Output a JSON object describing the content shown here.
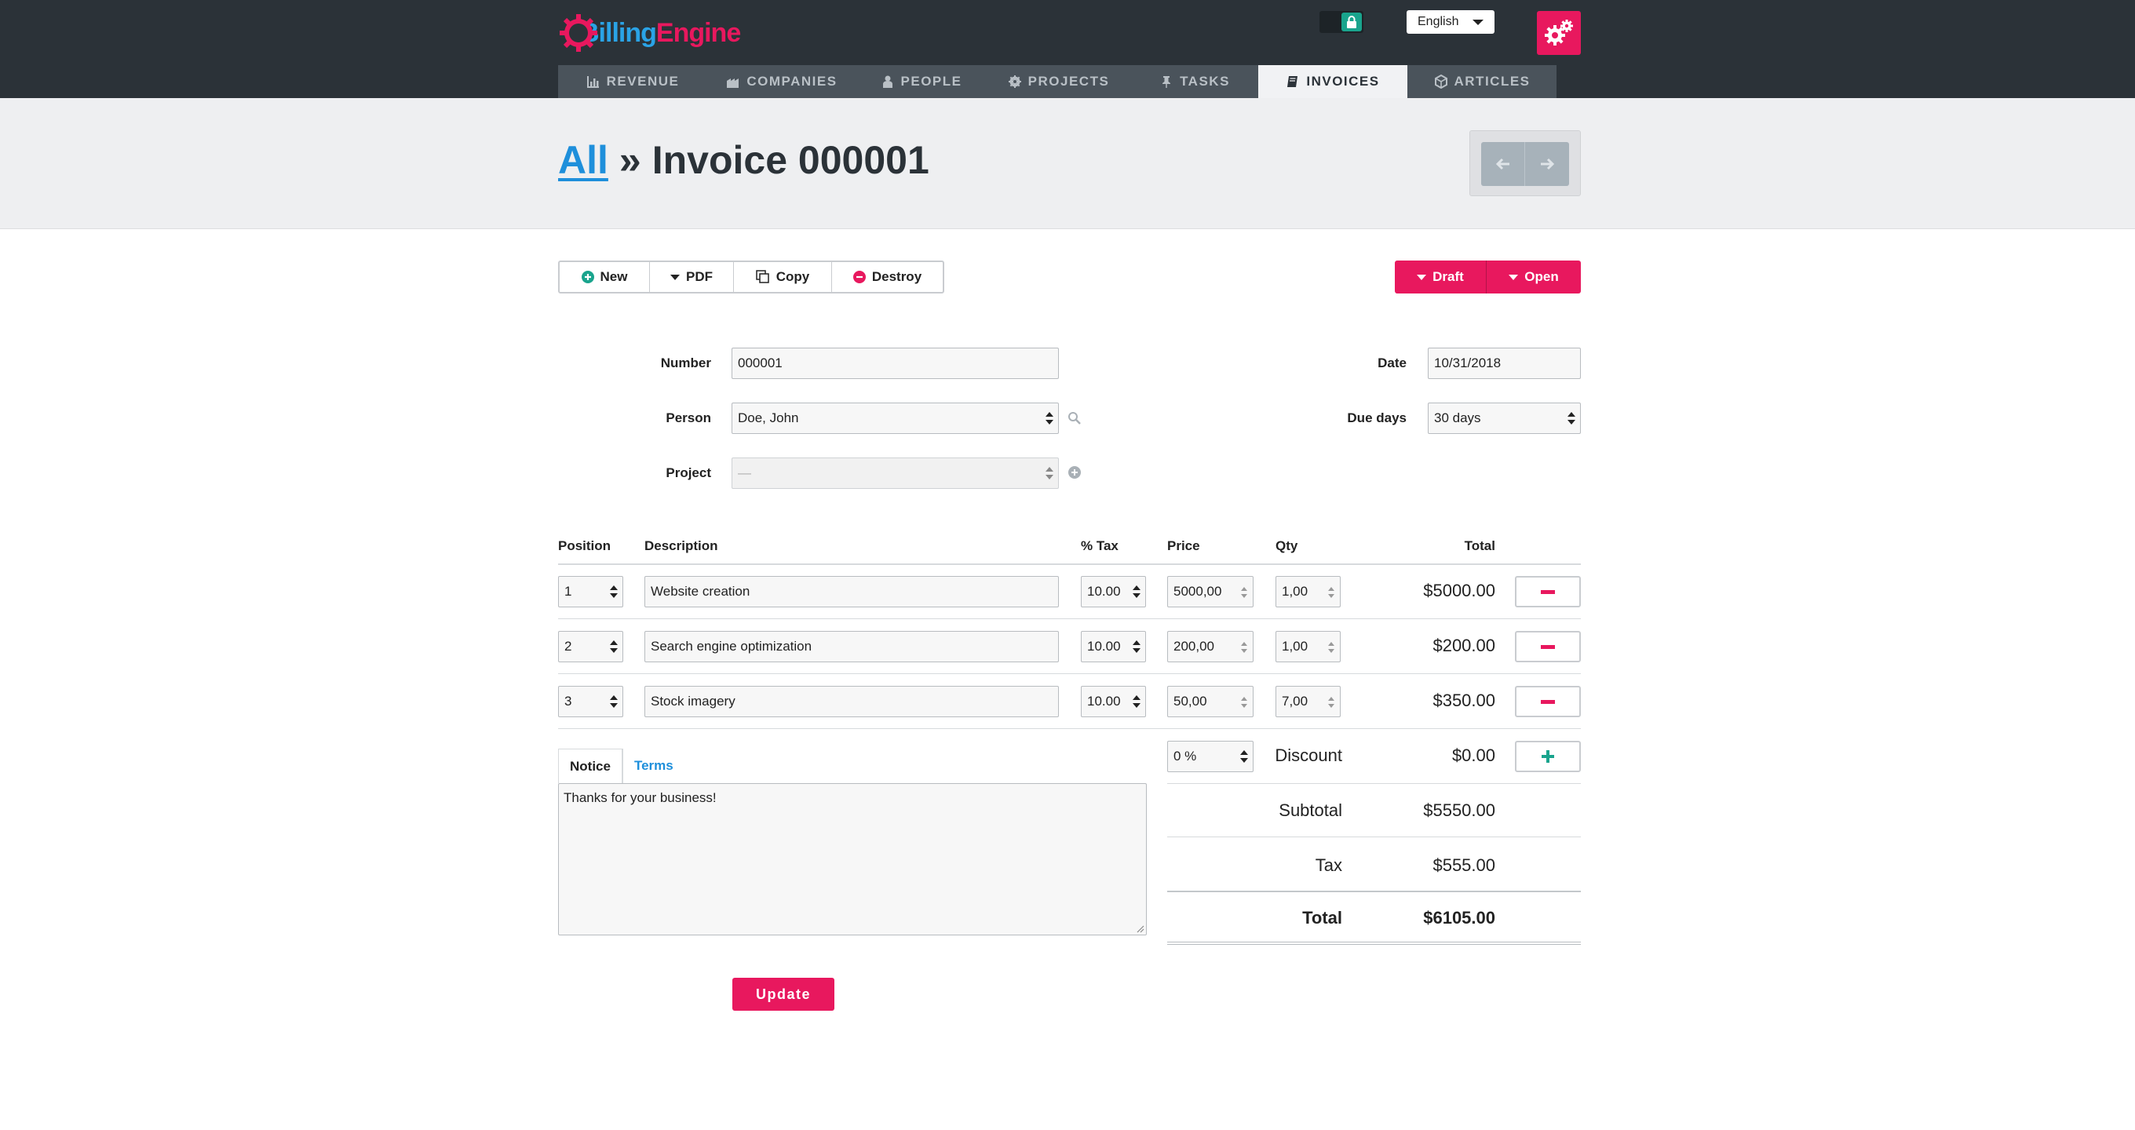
{
  "brand": {
    "name_part1": "Billing",
    "name_part2": "Engine"
  },
  "language": {
    "selected": "English"
  },
  "nav": {
    "tabs": [
      {
        "label": "REVENUE",
        "icon": "bar-chart-icon"
      },
      {
        "label": "COMPANIES",
        "icon": "building-icon"
      },
      {
        "label": "PEOPLE",
        "icon": "user-icon"
      },
      {
        "label": "PROJECTS",
        "icon": "gear-icon"
      },
      {
        "label": "TASKS",
        "icon": "pin-icon"
      },
      {
        "label": "INVOICES",
        "icon": "book-icon",
        "active": true
      },
      {
        "label": "ARTICLES",
        "icon": "cube-icon"
      }
    ]
  },
  "breadcrumb": {
    "parent": "All",
    "separator": "»",
    "current": "Invoice 000001"
  },
  "toolbar": {
    "new": "New",
    "pdf": "PDF",
    "copy": "Copy",
    "destroy": "Destroy"
  },
  "status": {
    "draft": "Draft",
    "open": "Open"
  },
  "form": {
    "number_label": "Number",
    "number_value": "000001",
    "person_label": "Person",
    "person_value": "Doe, John",
    "project_label": "Project",
    "project_value": "—",
    "date_label": "Date",
    "date_value": "10/31/2018",
    "due_days_label": "Due days",
    "due_days_value": "30 days"
  },
  "table": {
    "headers": {
      "position": "Position",
      "description": "Description",
      "tax": "% Tax",
      "price": "Price",
      "qty": "Qty",
      "total": "Total"
    },
    "rows": [
      {
        "position": "1",
        "description": "Website creation",
        "tax": "10.00",
        "price": "5000,00",
        "qty": "1,00",
        "total": "$5000.00"
      },
      {
        "position": "2",
        "description": "Search engine optimization",
        "tax": "10.00",
        "price": "200,00",
        "qty": "1,00",
        "total": "$200.00"
      },
      {
        "position": "3",
        "description": "Stock imagery",
        "tax": "10.00",
        "price": "50,00",
        "qty": "7,00",
        "total": "$350.00"
      }
    ]
  },
  "notice": {
    "tab_notice": "Notice",
    "tab_terms": "Terms",
    "text": "Thanks for your business!"
  },
  "summary": {
    "discount_select": "0 %",
    "discount_label": "Discount",
    "discount_value": "$0.00",
    "subtotal_label": "Subtotal",
    "subtotal_value": "$5550.00",
    "tax_label": "Tax",
    "tax_value": "$555.00",
    "total_label": "Total",
    "total_value": "$6105.00"
  },
  "actions": {
    "update": "Update"
  },
  "colors": {
    "accent": "#e8185e",
    "link": "#1e8fdb",
    "topbar": "#2b3238",
    "teal": "#19a48d"
  }
}
